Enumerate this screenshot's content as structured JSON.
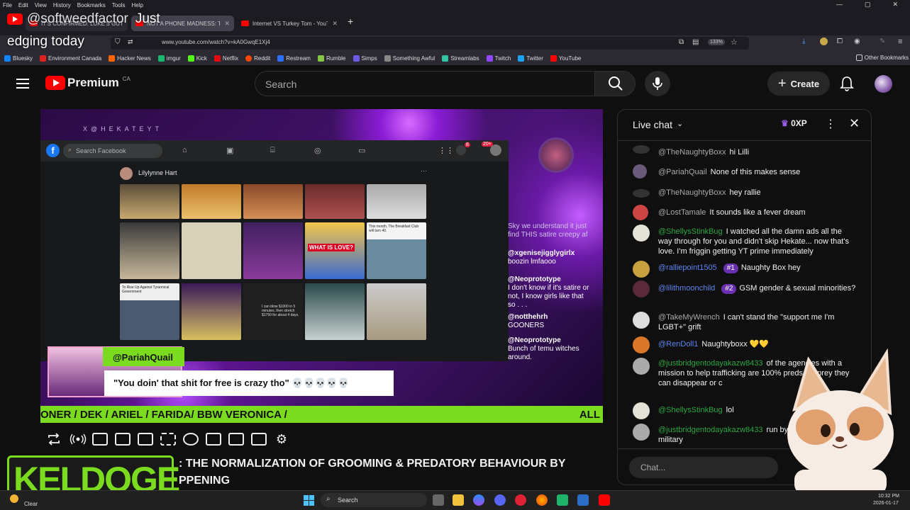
{
  "browser": {
    "menu": [
      "File",
      "Edit",
      "View",
      "History",
      "Bookmarks",
      "Tools",
      "Help"
    ],
    "tabs": [
      {
        "title": "IT'S CONFIRMED: LUKE'S GUT"
      },
      {
        "title": "NOT A PHONE MADNESS: Th"
      },
      {
        "title": "Internet VS Turkey Tom - YouTu"
      }
    ],
    "new_tab": "+",
    "url": "www.youtube.com/watch?v=kA0GwqE1Xj4",
    "zoom": "133%",
    "bookmarks": [
      "Bluesky",
      "Environment Canada",
      "Hacker News",
      "imgur",
      "Kick",
      "Netflix",
      "Reddit",
      "Restream",
      "Rumble",
      "Simps",
      "Something Awful",
      "Streamlabs",
      "Twitch",
      "Twitter",
      "YouTube"
    ],
    "other_bookmarks": "Other Bookmarks"
  },
  "overlay": {
    "handle": "@softweedfactor",
    "caption_line1": "Just",
    "caption_line2": "edging today",
    "logo_text": "KELDOGE"
  },
  "youtube": {
    "logo": "Premium",
    "region": "CA",
    "search_placeholder": "Search",
    "create_label": "Create"
  },
  "video": {
    "banner": "X@HEKATEYT",
    "fb_search": "Search Facebook",
    "fb_notif_count": "8",
    "fb_notif_count2": "20+",
    "fb_post_author": "Lilylynne Hart",
    "fb_thumb_texts": [
      "WHAT IS LOVE?",
      "To Rise Up Against Tyrannical Government",
      "I can blow $1000 in 5 minutes, then stretch $1750 for about 4 days.",
      "This month, The Breakfast Club will turn 40."
    ],
    "stream_overlay_name": "@PariahQuail",
    "stream_overlay_quote": "\"You doin' that shit for free is crazy tho\" 💀💀💀💀💀",
    "side_chat": [
      {
        "text": "Sky we understand it just find THIS satire creepy af"
      },
      {
        "user": "@xgenisejigglygirlx",
        "text": "boozin lmfaooo"
      },
      {
        "user": "@Neoprototype",
        "text": "I don't know if it's satire or not, I know girls like that so . . ."
      },
      {
        "user": "@notthehrh",
        "text": "GOONERS"
      },
      {
        "user": "@Neoprototype",
        "text": "Bunch of temu witches around."
      }
    ],
    "ticker": "ONER / DEK / ARIEL / FARIDA/ BBW VERONICA /",
    "ticker_right": "ALL",
    "title_line1": ": THE NORMALIZATION OF GROOMING & PREDATORY BEHAVIOUR BY",
    "title_line2": "PPENING"
  },
  "chat": {
    "title": "Live chat",
    "xp": "0XP",
    "messages": [
      {
        "author": "@TheNaughtyBoxx",
        "text": "hi Lilli",
        "color": "#aaaaaa"
      },
      {
        "author": "@PariahQuail",
        "text": "None of this makes sense",
        "color": "#aaaaaa"
      },
      {
        "author": "@TheNaughtyBoxx",
        "text": "hey rallie",
        "color": "#aaaaaa"
      },
      {
        "author": "@LostTamale",
        "text": "It sounds like a fever dream",
        "color": "#aaaaaa"
      },
      {
        "author": "@ShellysStinkBug",
        "text": "I watched all the damn ads all the way through for you and didn't skip Hekate... now that's love. I'm friggin getting YT prime immediately",
        "color": "#2ba640"
      },
      {
        "author": "@ralliepoint1505",
        "badge": "#1",
        "text": "Naughty Box hey",
        "color": "#5e84f1"
      },
      {
        "author": "@lilithmoonchild",
        "badge": "#2",
        "text": "GSM gender & sexual minorities?",
        "color": "#5e84f1"
      },
      {
        "author": "@TakeMyWrench",
        "text": "I can't stand the \"support me I'm LGBT+\" grift",
        "color": "#aaaaaa"
      },
      {
        "author": "@RenDoll1",
        "text": "Naughtyboxx 💛💛",
        "color": "#5e84f1"
      },
      {
        "author": "@justbridgentodayakazw8433",
        "text": "of the agencies with a mission to help trafficking are 100% preds wh prey they can disappear or c",
        "color": "#2ba640"
      },
      {
        "author": "@ShellysStinkBug",
        "text": "lol",
        "color": "#2ba640"
      },
      {
        "author": "@justbridgentodayakazw8433",
        "text": "run by the govt and military",
        "color": "#2ba640"
      }
    ],
    "input_placeholder": "Chat..."
  },
  "taskbar": {
    "weather": "Clear",
    "search": "Search",
    "time": "10:32 PM",
    "date": "2026-01-17"
  },
  "colors": {
    "yt_red": "#ff0000",
    "ticker_green": "#7bdc1f",
    "chat_green": "#2ba640",
    "chat_blue": "#5e84f1",
    "badge_purple": "#6a2fb0"
  }
}
